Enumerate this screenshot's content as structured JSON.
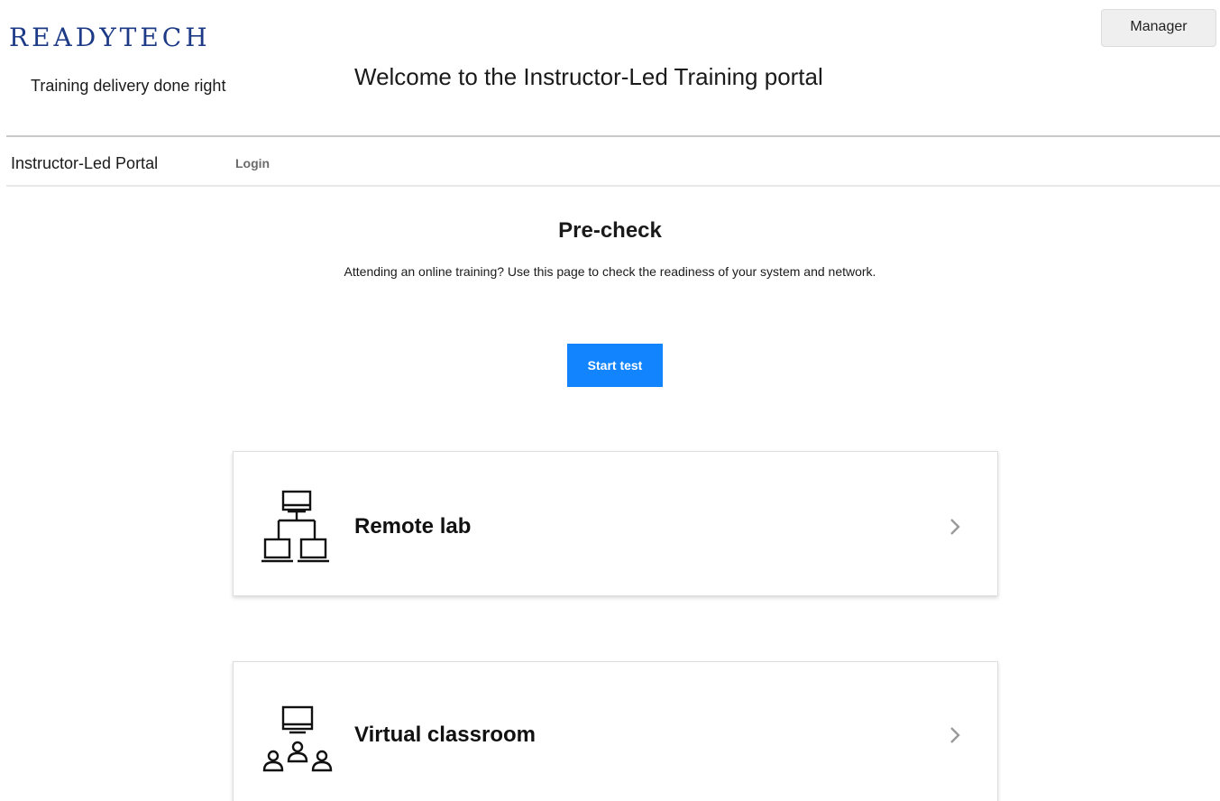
{
  "header": {
    "logo_text": "READYTECH",
    "tagline": "Training delivery done right",
    "welcome": "Welcome to the Instructor-Led Training portal",
    "manager_label": "Manager"
  },
  "nav": {
    "brand": "Instructor-Led Portal",
    "login_label": "Login"
  },
  "precheck": {
    "title": "Pre-check",
    "description": "Attending an online training? Use this page to check the readiness of your system and network.",
    "start_label": "Start test"
  },
  "cards": [
    {
      "title": "Remote lab",
      "icon": "network-computers-icon"
    },
    {
      "title": "Virtual classroom",
      "icon": "classroom-users-icon"
    }
  ],
  "colors": {
    "logo": "#1d3a86",
    "primary_button": "#1284fe"
  }
}
